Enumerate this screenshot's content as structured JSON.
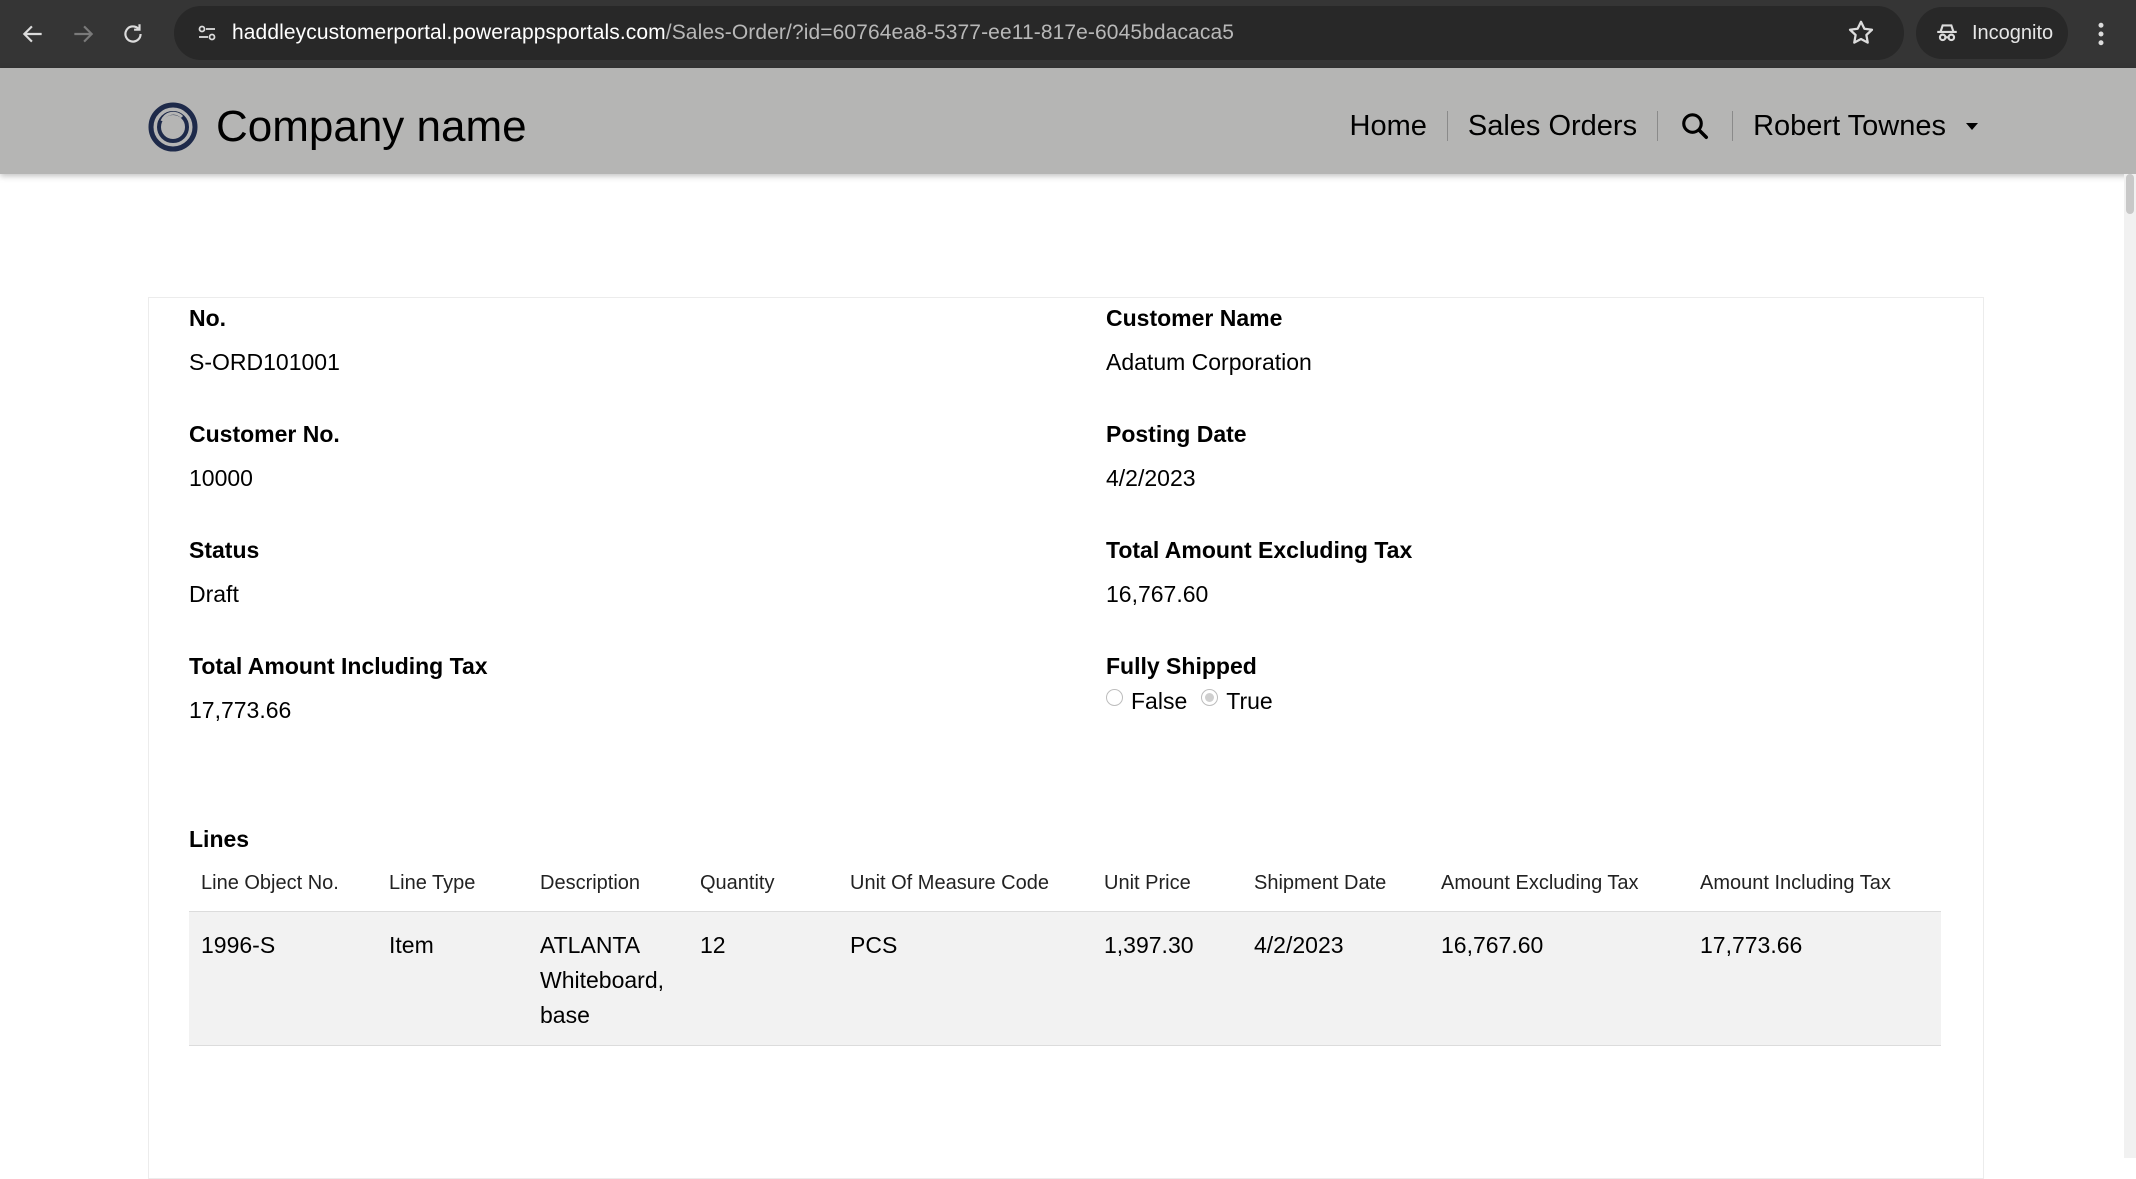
{
  "browser": {
    "url_host": "haddleycustomerportal.powerappsportals.com",
    "url_path": "/Sales-Order/?id=60764ea8-5377-ee11-817e-6045bdacaca5",
    "incognito_label": "Incognito"
  },
  "header": {
    "company_name": "Company name",
    "nav": {
      "home": "Home",
      "sales_orders": "Sales Orders",
      "user_name": "Robert Townes"
    }
  },
  "order": {
    "no_label": "No.",
    "no_value": "S-ORD101001",
    "customer_name_label": "Customer Name",
    "customer_name_value": "Adatum Corporation",
    "customer_no_label": "Customer No.",
    "customer_no_value": "10000",
    "posting_date_label": "Posting Date",
    "posting_date_value": "4/2/2023",
    "status_label": "Status",
    "status_value": "Draft",
    "total_excl_label": "Total Amount Excluding Tax",
    "total_excl_value": "16,767.60",
    "total_incl_label": "Total Amount Including Tax",
    "total_incl_value": "17,773.66",
    "fully_shipped_label": "Fully Shipped",
    "fully_shipped_options": [
      "False",
      "True"
    ],
    "fully_shipped_selected": "True"
  },
  "lines": {
    "title": "Lines",
    "columns": [
      "Line Object No.",
      "Line Type",
      "Description",
      "Quantity",
      "Unit Of Measure Code",
      "Unit Price",
      "Shipment Date",
      "Amount Excluding Tax",
      "Amount Including Tax"
    ],
    "rows": [
      [
        "1996-S",
        "Item",
        "ATLANTA Whiteboard, base",
        "12",
        "PCS",
        "1,397.30",
        "4/2/2023",
        "16,767.60",
        "17,773.66"
      ]
    ]
  }
}
